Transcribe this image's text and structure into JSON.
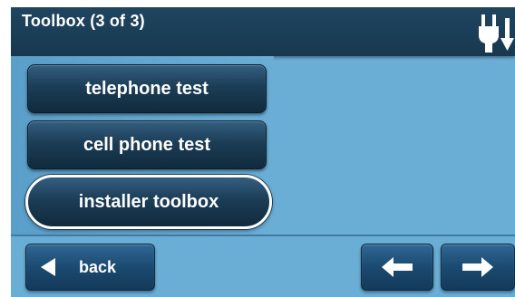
{
  "header": {
    "title": "Toolbox (3 of 3)",
    "status_icon": "power-plug-icon"
  },
  "menu": {
    "items": [
      {
        "label": "telephone test",
        "selected": false
      },
      {
        "label": "cell phone test",
        "selected": false
      },
      {
        "label": "installer toolbox",
        "selected": true
      }
    ]
  },
  "footer": {
    "back_label": "back",
    "back_icon": "left-triangle-icon",
    "prev_icon": "left-arrow-icon",
    "next_icon": "right-arrow-icon"
  },
  "colors": {
    "background": "#6aaed6",
    "header": "#1f4560",
    "button": "#1c3d56",
    "text": "#ffffff"
  }
}
